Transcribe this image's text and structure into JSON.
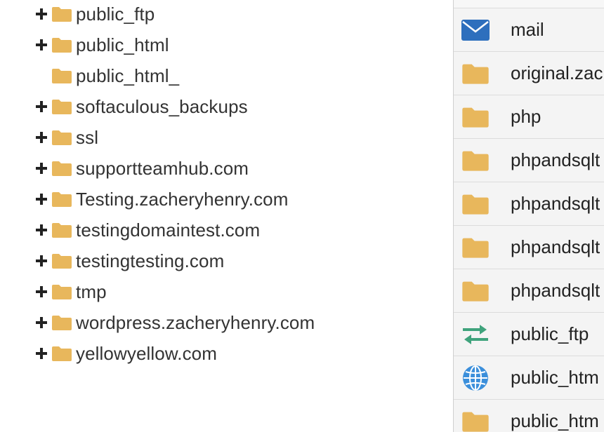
{
  "colors": {
    "folder": "#e8b75c",
    "mail": "#2e6fbd",
    "transfer": "#3fa37c",
    "globe": "#3b8fdb"
  },
  "tree": {
    "items": [
      {
        "label": "public_ftp",
        "expandable": true,
        "icon": "folder-icon"
      },
      {
        "label": "public_html",
        "expandable": true,
        "icon": "folder-icon"
      },
      {
        "label": "public_html_",
        "expandable": false,
        "icon": "folder-icon"
      },
      {
        "label": "softaculous_backups",
        "expandable": true,
        "icon": "folder-icon"
      },
      {
        "label": "ssl",
        "expandable": true,
        "icon": "folder-icon"
      },
      {
        "label": "supportteamhub.com",
        "expandable": true,
        "icon": "folder-icon"
      },
      {
        "label": "Testing.zacheryhenry.com",
        "expandable": true,
        "icon": "folder-icon"
      },
      {
        "label": "testingdomaintest.com",
        "expandable": true,
        "icon": "folder-icon"
      },
      {
        "label": "testingtesting.com",
        "expandable": true,
        "icon": "folder-icon"
      },
      {
        "label": "tmp",
        "expandable": true,
        "icon": "folder-icon"
      },
      {
        "label": "wordpress.zacheryhenry.com",
        "expandable": true,
        "icon": "folder-icon"
      },
      {
        "label": "yellowyellow.com",
        "expandable": true,
        "icon": "folder-icon"
      }
    ]
  },
  "files": {
    "items": [
      {
        "label": "mail",
        "icon": "mail-icon"
      },
      {
        "label": "original.zac",
        "icon": "folder-icon"
      },
      {
        "label": "php",
        "icon": "folder-icon"
      },
      {
        "label": "phpandsqlt",
        "icon": "folder-icon"
      },
      {
        "label": "phpandsqlt",
        "icon": "folder-icon"
      },
      {
        "label": "phpandsqlt",
        "icon": "folder-icon"
      },
      {
        "label": "phpandsqlt",
        "icon": "folder-icon"
      },
      {
        "label": "public_ftp",
        "icon": "transfer-arrows-icon"
      },
      {
        "label": "public_htm",
        "icon": "globe-icon"
      },
      {
        "label": "public_htm",
        "icon": "folder-icon"
      }
    ]
  }
}
